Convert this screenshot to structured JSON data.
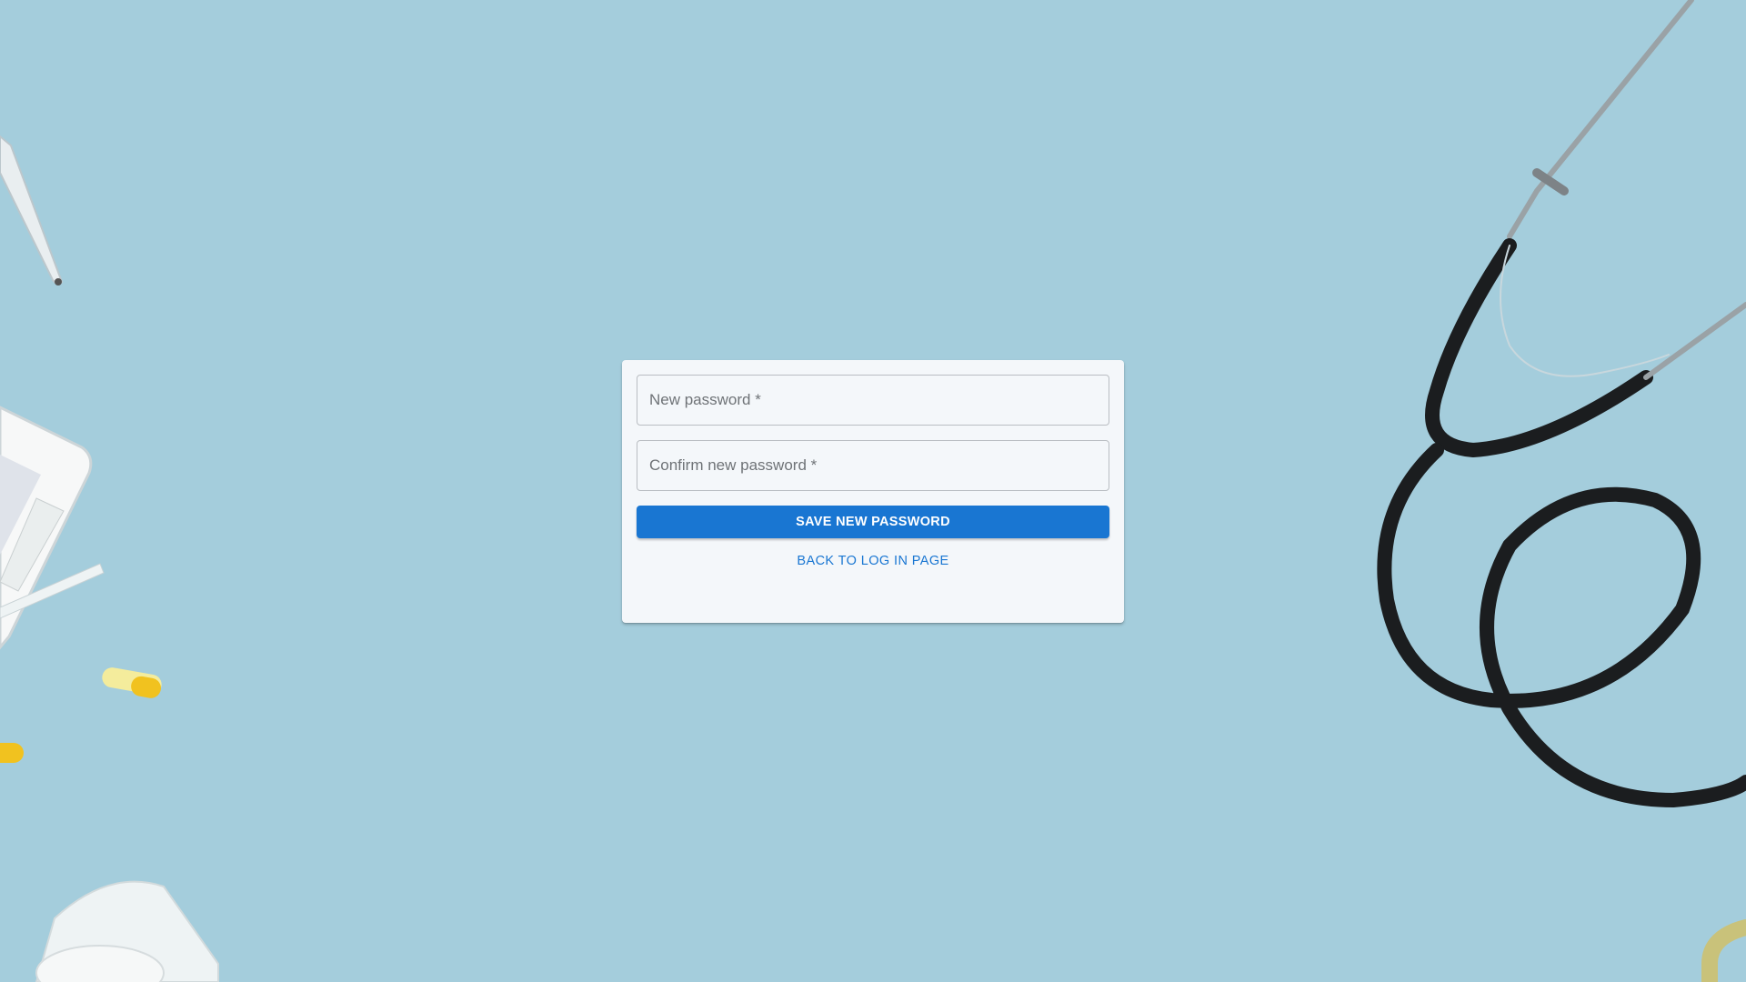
{
  "form": {
    "new_password": {
      "value": "",
      "placeholder": "New password *"
    },
    "confirm_password": {
      "value": "",
      "placeholder": "Confirm new password *"
    },
    "save_label": "SAVE NEW PASSWORD",
    "back_label": "BACK TO LOG IN PAGE"
  },
  "colors": {
    "background": "#a4cddc",
    "card": "#f4f7fa",
    "primary": "#1976d2"
  },
  "icons": {
    "thermometer": "thermometer-icon",
    "stethoscope": "stethoscope-icon",
    "capsule": "capsule-icon"
  }
}
